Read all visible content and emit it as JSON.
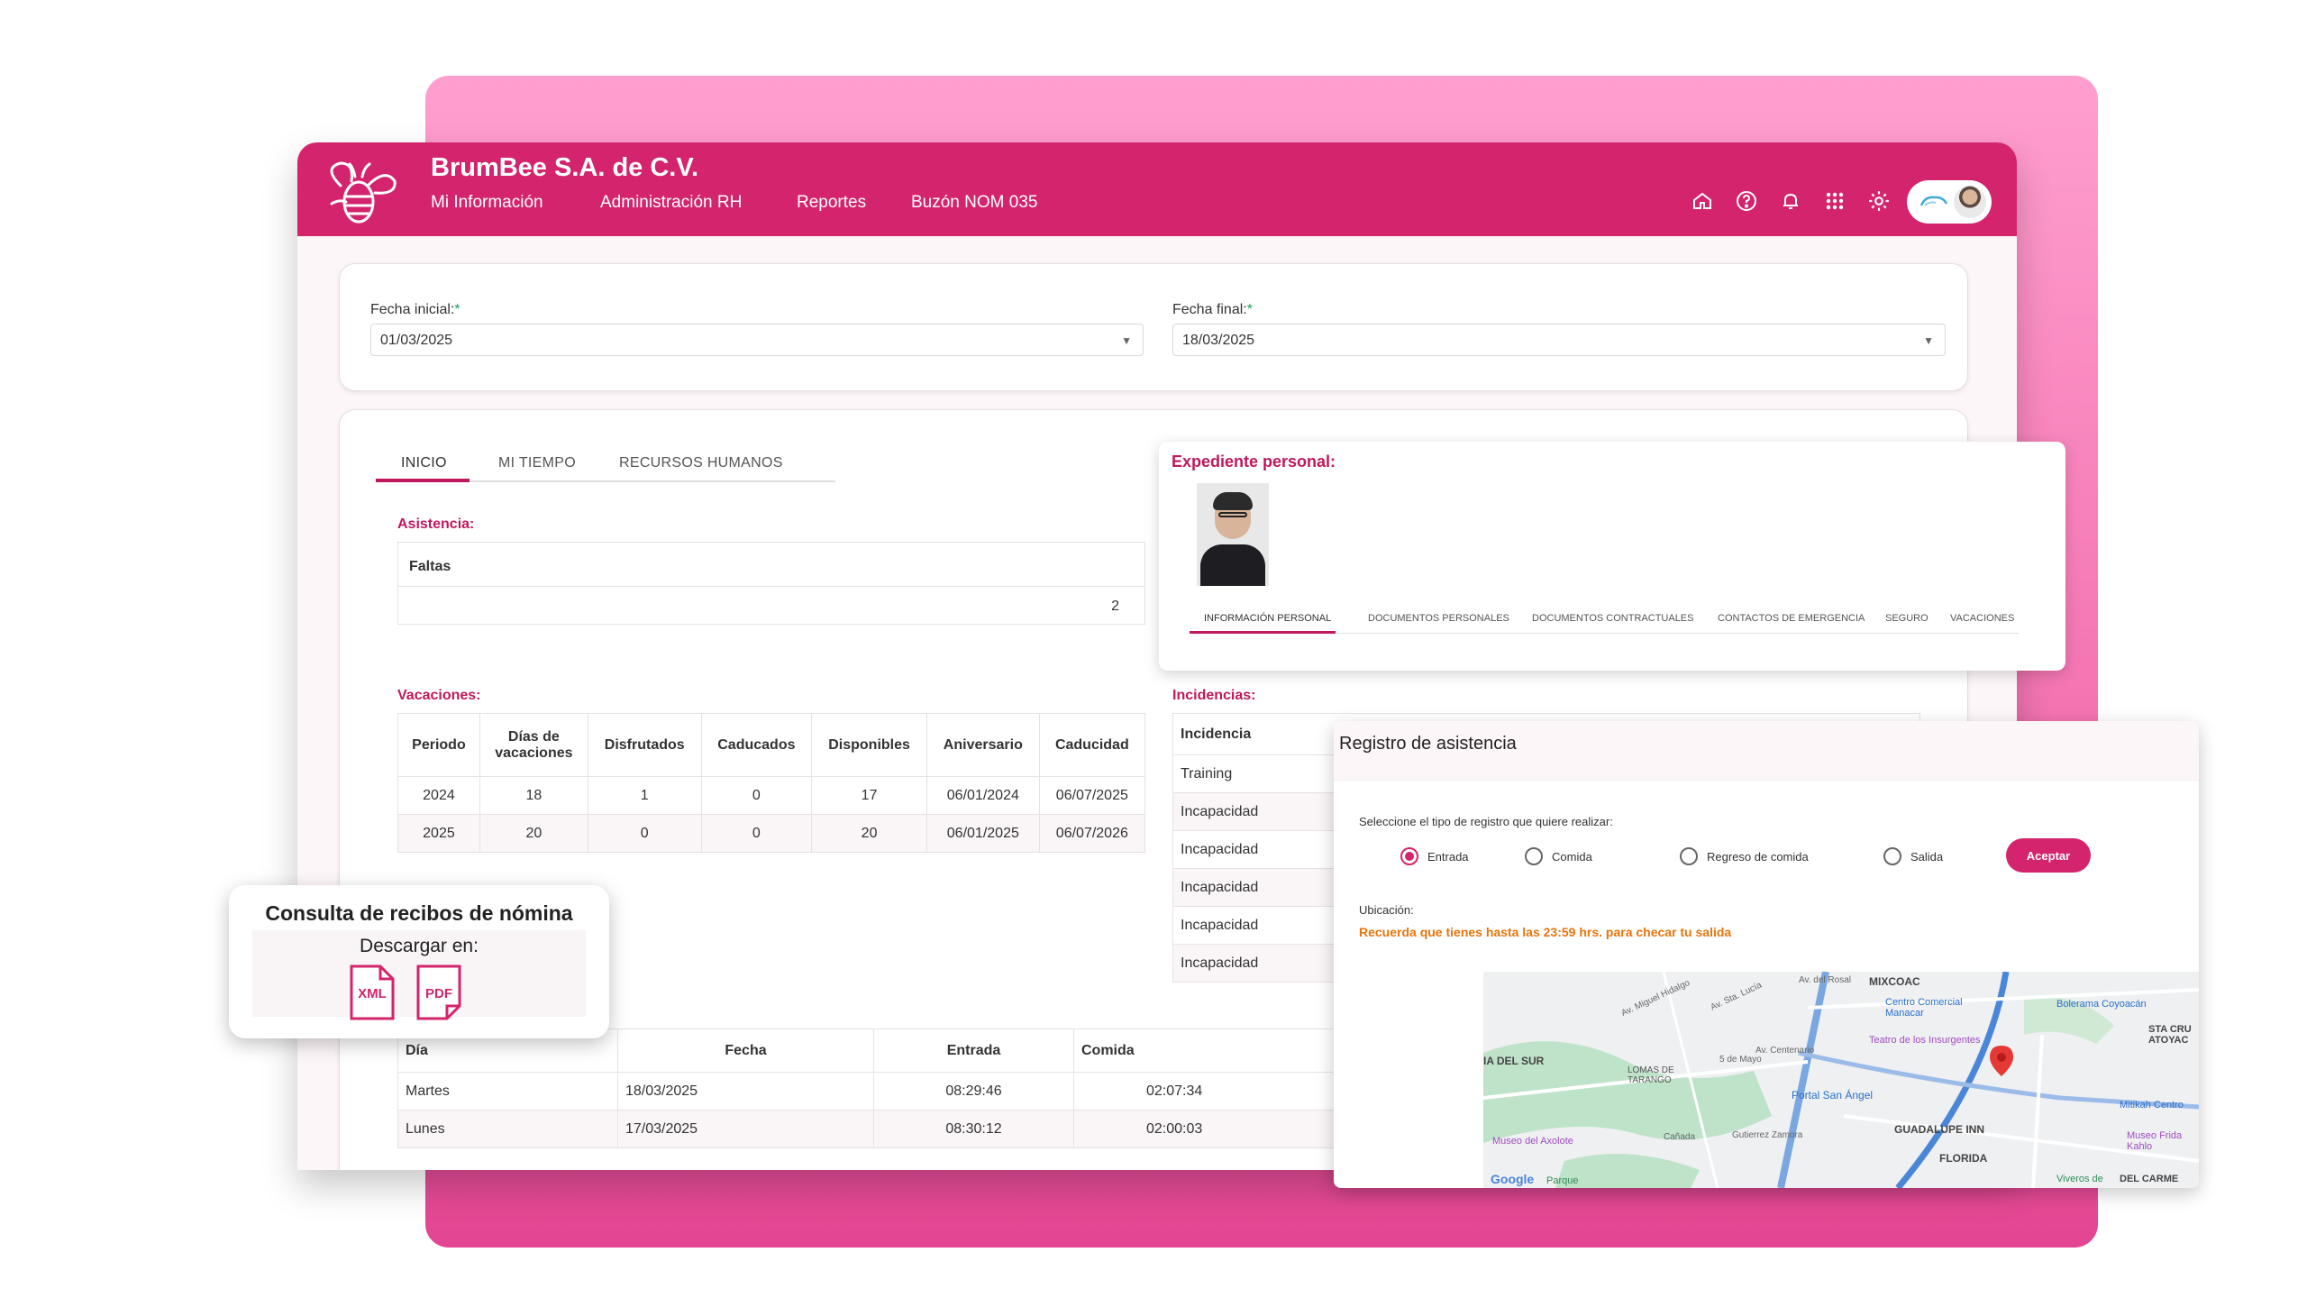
{
  "header": {
    "company": "BrumBee S.A. de C.V.",
    "nav": [
      "Mi Información",
      "Administración RH",
      "Reportes",
      "Buzón NOM 035"
    ],
    "icons": [
      "home-icon",
      "help-icon",
      "bell-icon",
      "apps-grid-icon",
      "gear-icon"
    ],
    "logo_text": "bee"
  },
  "filters": {
    "start_label": "Fecha inicial:",
    "start_value": "01/03/2025",
    "end_label": "Fecha final:",
    "end_value": "18/03/2025",
    "required_mark": "*"
  },
  "tabs": [
    "INICIO",
    "MI TIEMPO",
    "RECURSOS HUMANOS"
  ],
  "asistencia": {
    "title": "Asistencia:",
    "header": "Faltas",
    "value": "2"
  },
  "vacaciones": {
    "title": "Vacaciones:",
    "columns": [
      "Periodo",
      "Días de vacaciones",
      "Disfrutados",
      "Caducados",
      "Disponibles",
      "Aniversario",
      "Caducidad"
    ],
    "rows": [
      [
        "2024",
        "18",
        "1",
        "0",
        "17",
        "06/01/2024",
        "06/07/2025"
      ],
      [
        "2025",
        "20",
        "0",
        "0",
        "20",
        "06/01/2025",
        "06/07/2026"
      ]
    ]
  },
  "incidencias": {
    "title": "Incidencias:",
    "header": "Incidencia",
    "rows": [
      "Training",
      "Incapacidad",
      "Incapacidad",
      "Incapacidad",
      "Incapacidad",
      "Incapacidad"
    ]
  },
  "registros": {
    "columns": [
      "Día",
      "Fecha",
      "Entrada",
      "Comida"
    ],
    "rows": [
      [
        "Martes",
        "18/03/2025",
        "08:29:46",
        "02:07:34"
      ],
      [
        "Lunes",
        "17/03/2025",
        "08:30:12",
        "02:00:03"
      ]
    ]
  },
  "expediente": {
    "title": "Expediente personal:",
    "tabs": [
      "INFORMACIÓN PERSONAL",
      "DOCUMENTOS PERSONALES",
      "DOCUMENTOS CONTRACTUALES",
      "CONTACTOS DE EMERGENCIA",
      "SEGURO",
      "VACACIONES"
    ]
  },
  "registro_asistencia": {
    "title": "Registro de asistencia",
    "prompt": "Seleccione el tipo de registro que quiere realizar:",
    "options": [
      "Entrada",
      "Comida",
      "Regreso de comida",
      "Salida"
    ],
    "selected": "Entrada",
    "accept": "Aceptar",
    "ubicacion_label": "Ubicación:",
    "warning": "Recuerda que tienes hasta las 23:59 hrs. para checar tu salida",
    "map_labels": [
      "MIXCOAC",
      "Centro Comercial Manacar",
      "Bolerama Coyoacán",
      "Teatro de los Insurgentes",
      "Portal San Ángel",
      "GUADALUPE INN",
      "FLORIDA",
      "Museo del Axolote",
      "STA CRU ATOYAC",
      "Mitikah Centro",
      "Museo Frida Kahlo",
      "Viveros de",
      "DEL CARME",
      "Av. Miguel Hidalgo",
      "Av. Sta. Lucía",
      "Av. del Rosal",
      "Av. Centenario",
      "5 de Mayo",
      "LOMAS DE TARANGO",
      "Gutierrez Zamora",
      "Cañada",
      "Parque",
      "IA DEL SUR"
    ],
    "map_brand": "Google",
    "accent": "#d3246d",
    "warning_color": "#e8750c"
  },
  "recibos": {
    "title": "Consulta de recibos de nómina",
    "subtitle": "Descargar en:",
    "formats": [
      "XML",
      "PDF"
    ]
  },
  "colors": {
    "brand": "#d3246d",
    "section": "#c0185e",
    "backdrop": "#f26fae"
  }
}
